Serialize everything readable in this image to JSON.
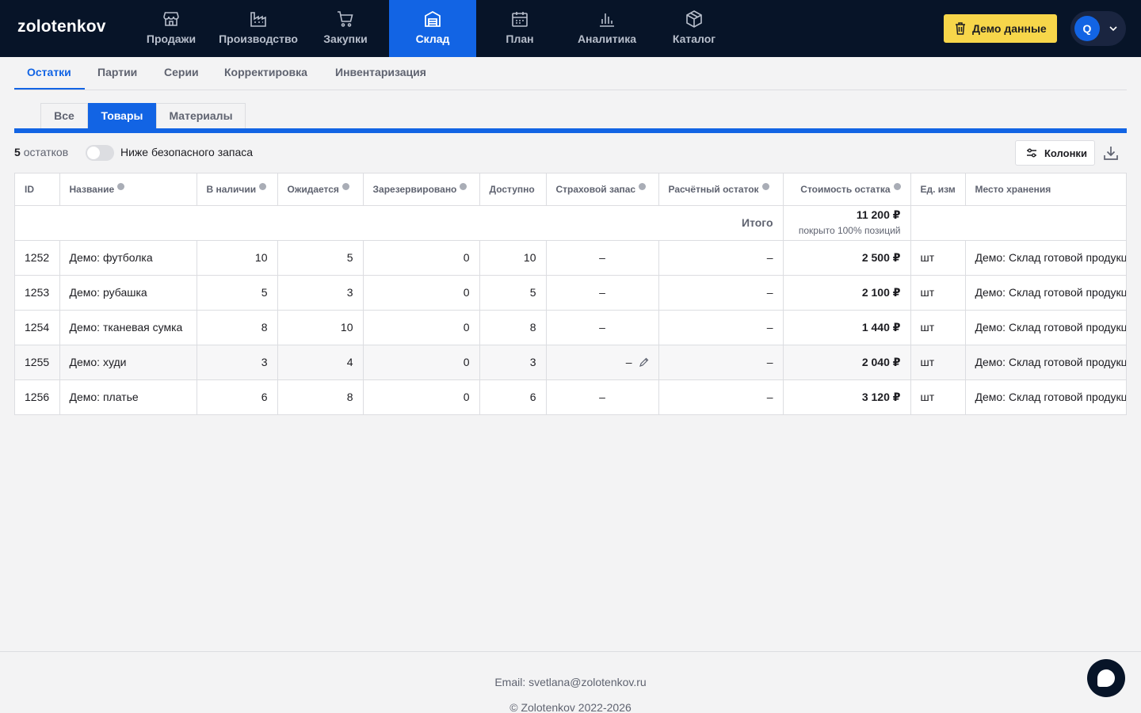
{
  "app": {
    "logo": "zolotenkov"
  },
  "nav": [
    {
      "label": "Продажи",
      "icon": "store-icon"
    },
    {
      "label": "Производство",
      "icon": "factory-icon"
    },
    {
      "label": "Закупки",
      "icon": "cart-icon"
    },
    {
      "label": "Склад",
      "icon": "warehouse-icon",
      "active": true
    },
    {
      "label": "План",
      "icon": "calendar-icon"
    },
    {
      "label": "Аналитика",
      "icon": "bar-chart-icon"
    },
    {
      "label": "Каталог",
      "icon": "box-icon"
    }
  ],
  "header": {
    "demo_button": "Демо данные",
    "avatar_letter": "Q"
  },
  "subtabs": [
    "Остатки",
    "Партии",
    "Серии",
    "Корректировка",
    "Инвентаризация"
  ],
  "segments": [
    "Все",
    "Товары",
    "Материалы"
  ],
  "toolbar": {
    "count": "5",
    "count_suffix": "остатков",
    "toggle_label": "Ниже безопасного запаса",
    "columns_button": "Колонки"
  },
  "table": {
    "columns": [
      "ID",
      "Название",
      "В наличии",
      "Ожидается",
      "Зарезервировано",
      "Доступно",
      "Страховой запас",
      "Расчётный остаток",
      "Стоимость остатка",
      "Ед. изм",
      "Место хранения"
    ],
    "total": {
      "label": "Итого",
      "value": "11 200 ₽",
      "sub": "покрыто 100% позиций"
    },
    "rows": [
      {
        "id": "1252",
        "name": "Демо: футболка",
        "in_stock": "10",
        "expected": "5",
        "reserved": "0",
        "available": "10",
        "safety": "–",
        "calc": "–",
        "cost": "2 500 ₽",
        "unit": "шт",
        "location": "Демо: Склад готовой продукции"
      },
      {
        "id": "1253",
        "name": "Демо: рубашка",
        "in_stock": "5",
        "expected": "3",
        "reserved": "0",
        "available": "5",
        "safety": "–",
        "calc": "–",
        "cost": "2 100 ₽",
        "unit": "шт",
        "location": "Демо: Склад готовой продукции"
      },
      {
        "id": "1254",
        "name": "Демо: тканевая сумка",
        "in_stock": "8",
        "expected": "10",
        "reserved": "0",
        "available": "8",
        "safety": "–",
        "calc": "–",
        "cost": "1 440 ₽",
        "unit": "шт",
        "location": "Демо: Склад готовой продукции"
      },
      {
        "id": "1255",
        "name": "Демо: худи",
        "in_stock": "3",
        "expected": "4",
        "reserved": "0",
        "available": "3",
        "safety": "–",
        "calc": "–",
        "cost": "2 040 ₽",
        "unit": "шт",
        "location": "Демо: Склад готовой продукции"
      },
      {
        "id": "1256",
        "name": "Демо: платье",
        "in_stock": "6",
        "expected": "8",
        "reserved": "0",
        "available": "6",
        "safety": "–",
        "calc": "–",
        "cost": "3 120 ₽",
        "unit": "шт",
        "location": "Демо: Склад готовой продукции"
      }
    ]
  },
  "footer": {
    "email": "Email: svetlana@zolotenkov.ru",
    "copyright": "© Zolotenkov 2022-2026"
  }
}
